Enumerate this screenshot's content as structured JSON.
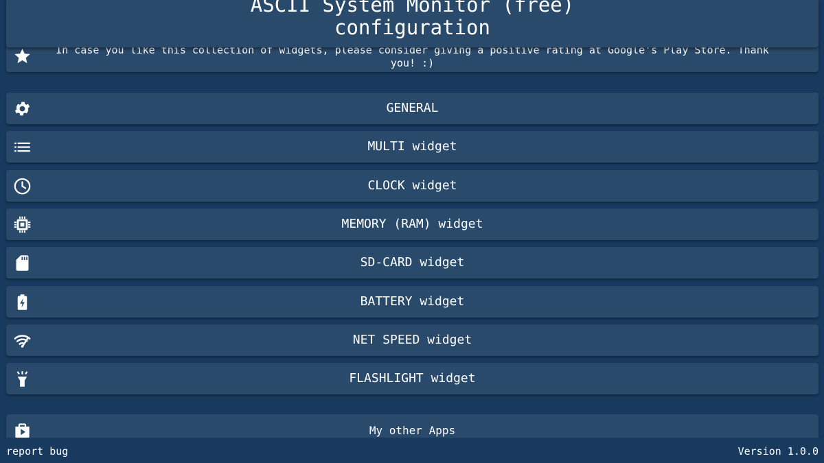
{
  "header": {
    "title_line1": "ASCII System Monitor (free)",
    "title_line2": "configuration"
  },
  "rating_card": {
    "icon": "star-icon",
    "text": "In case you like this collection of widgets, please consider giving a positive rating at Google's Play Store. Thank you! :)"
  },
  "menu": [
    {
      "icon": "gear-icon",
      "label": "GENERAL"
    },
    {
      "icon": "list-icon",
      "label": "MULTI widget"
    },
    {
      "icon": "clock-icon",
      "label": "CLOCK widget"
    },
    {
      "icon": "chip-icon",
      "label": "MEMORY (RAM) widget"
    },
    {
      "icon": "sd-card-icon",
      "label": "SD-CARD widget"
    },
    {
      "icon": "battery-charging-icon",
      "label": "BATTERY widget"
    },
    {
      "icon": "wifi-speed-icon",
      "label": "NET SPEED widget"
    },
    {
      "icon": "flashlight-icon",
      "label": "FLASHLIGHT widget"
    }
  ],
  "other_apps": {
    "icon": "shop-icon",
    "label": "My other Apps"
  },
  "footer": {
    "report_bug": "report bug",
    "version": "Version 1.0.0"
  },
  "colors": {
    "background": "#183a5e",
    "card": "#2a4a6c",
    "text": "#ffffff"
  }
}
